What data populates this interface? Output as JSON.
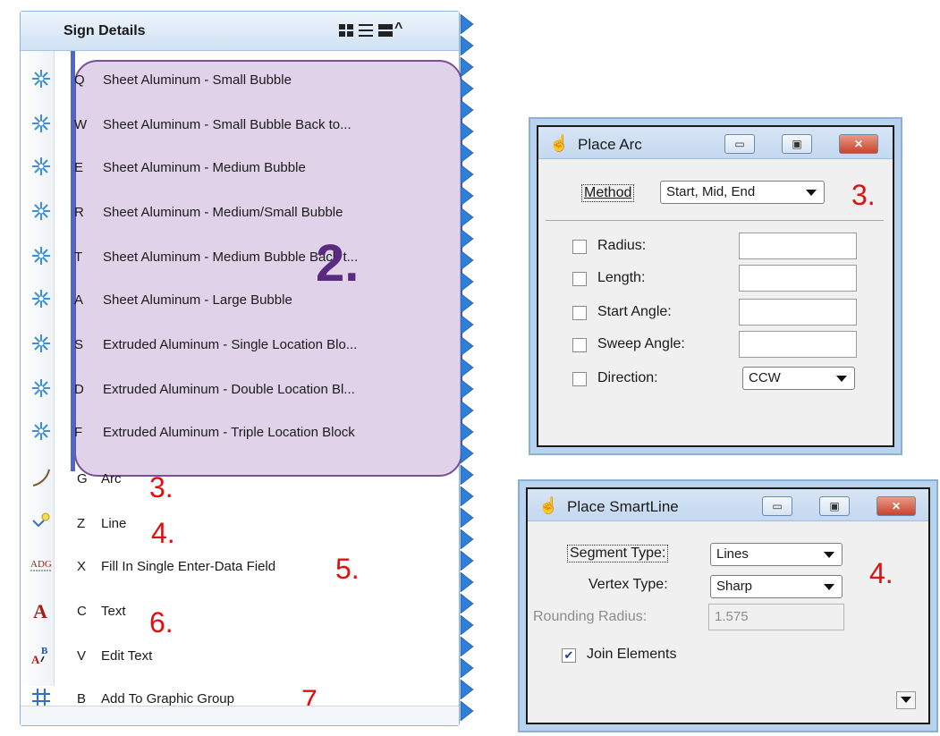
{
  "sign_details": {
    "title": "Sign Details",
    "view_icons": [
      "grid-view-icon",
      "list-view-icon",
      "detail-view-icon",
      "collapse-icon"
    ],
    "tools": [
      {
        "key": "Q",
        "label": "Sheet Aluminum - Small Bubble",
        "icon": "sign-cell-icon"
      },
      {
        "key": "W",
        "label": "Sheet Aluminum - Small Bubble Back to...",
        "icon": "sign-cell-icon"
      },
      {
        "key": "E",
        "label": "Sheet Aluminum - Medium Bubble",
        "icon": "sign-cell-icon"
      },
      {
        "key": "R",
        "label": "Sheet Aluminum - Medium/Small Bubble",
        "icon": "sign-cell-icon"
      },
      {
        "key": "T",
        "label": "Sheet Aluminum - Medium Bubble Back t...",
        "icon": "sign-cell-icon"
      },
      {
        "key": "A",
        "label": "Sheet Aluminum - Large Bubble",
        "icon": "sign-cell-icon"
      },
      {
        "key": "S",
        "label": "Extruded Aluminum - Single Location Blo...",
        "icon": "sign-cell-icon"
      },
      {
        "key": "D",
        "label": "Extruded Aluminum - Double Location Bl...",
        "icon": "sign-cell-icon"
      },
      {
        "key": "F",
        "label": "Extruded Aluminum - Triple Location Block",
        "icon": "sign-cell-icon"
      },
      {
        "key": "G",
        "label": "Arc",
        "icon": "arc-icon"
      },
      {
        "key": "Z",
        "label": "Line",
        "icon": "smartline-icon"
      },
      {
        "key": "X",
        "label": "Fill In Single Enter-Data Field",
        "icon": "enter-data-field-icon"
      },
      {
        "key": "C",
        "label": "Text",
        "icon": "text-icon"
      },
      {
        "key": "V",
        "label": "Edit Text",
        "icon": "edit-text-icon"
      },
      {
        "key": "B",
        "label": "Add To Graphic Group",
        "icon": "graphic-group-icon"
      }
    ],
    "annotations": {
      "n2": "2.",
      "n3": "3.",
      "n4": "4.",
      "n5": "5.",
      "n6": "6.",
      "n7": "7."
    }
  },
  "place_arc": {
    "title": "Place Arc",
    "method_label": "Method",
    "method_value": "Start, Mid, End",
    "radius_label": "Radius:",
    "length_label": "Length:",
    "start_angle_label": "Start Angle:",
    "sweep_angle_label": "Sweep Angle:",
    "direction_label": "Direction:",
    "direction_value": "CCW",
    "radius_value": "",
    "length_value": "",
    "start_angle_value": "",
    "sweep_angle_value": "",
    "annotation": "3."
  },
  "place_smartline": {
    "title": "Place SmartLine",
    "segment_type_label": "Segment Type:",
    "segment_type_value": "Lines",
    "vertex_type_label": "Vertex Type:",
    "vertex_type_value": "Sharp",
    "rounding_radius_label": "Rounding Radius:",
    "rounding_radius_value": "1.575",
    "join_elements_label": "Join Elements",
    "join_elements_checked": true,
    "annotation": "4."
  },
  "window_buttons": {
    "minimize": "▭",
    "maximize": "▣",
    "close": "✕"
  },
  "colors": {
    "highlight_fill": "#e0d3e9",
    "highlight_border": "#7a4e9c",
    "annotation_red": "#e01010",
    "key_strip": "#4f67c9"
  }
}
